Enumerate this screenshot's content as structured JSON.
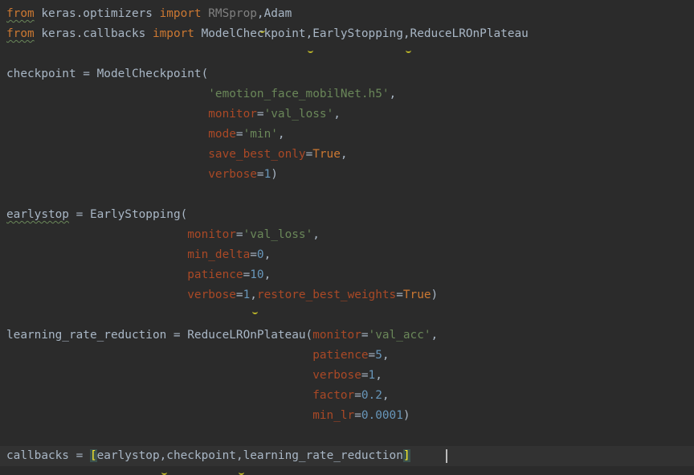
{
  "editor": {
    "lines": [
      [
        {
          "t": "from",
          "c": "kw typo"
        },
        {
          "t": " keras.optimizers ",
          "c": "plain"
        },
        {
          "t": "import",
          "c": "kw"
        },
        {
          "t": " ",
          "c": "plain"
        },
        {
          "t": "RMSprop",
          "c": "unused"
        },
        {
          "t": ",",
          "c": "plain",
          "w": 1
        },
        {
          "t": "Adam",
          "c": "plain"
        }
      ],
      [
        {
          "t": "from",
          "c": "kw typo"
        },
        {
          "t": " keras.callbacks ",
          "c": "plain"
        },
        {
          "t": "import",
          "c": "kw"
        },
        {
          "t": " ModelCheckpoint",
          "c": "plain"
        },
        {
          "t": ",",
          "c": "plain",
          "w": 1
        },
        {
          "t": "EarlyStopping",
          "c": "plain"
        },
        {
          "t": ",",
          "c": "plain",
          "w": 1
        },
        {
          "t": "ReduceLROnPlateau",
          "c": "plain"
        }
      ],
      [],
      [
        {
          "t": "checkpoint = ModelCheckpoint(",
          "c": "plain"
        }
      ],
      [
        {
          "t": "                             ",
          "c": "plain"
        },
        {
          "t": "'emotion_face_mobilNet.h5'",
          "c": "str"
        },
        {
          "t": ",",
          "c": "plain"
        }
      ],
      [
        {
          "t": "                             ",
          "c": "plain"
        },
        {
          "t": "monitor",
          "c": "param"
        },
        {
          "t": "=",
          "c": "plain"
        },
        {
          "t": "'val_loss'",
          "c": "str"
        },
        {
          "t": ",",
          "c": "plain"
        }
      ],
      [
        {
          "t": "                             ",
          "c": "plain"
        },
        {
          "t": "mode",
          "c": "param"
        },
        {
          "t": "=",
          "c": "plain"
        },
        {
          "t": "'min'",
          "c": "str"
        },
        {
          "t": ",",
          "c": "plain"
        }
      ],
      [
        {
          "t": "                             ",
          "c": "plain"
        },
        {
          "t": "save_best_only",
          "c": "param"
        },
        {
          "t": "=",
          "c": "plain"
        },
        {
          "t": "True",
          "c": "kwconst"
        },
        {
          "t": ",",
          "c": "plain"
        }
      ],
      [
        {
          "t": "                             ",
          "c": "plain"
        },
        {
          "t": "verbose",
          "c": "param"
        },
        {
          "t": "=",
          "c": "plain"
        },
        {
          "t": "1",
          "c": "num"
        },
        {
          "t": ")",
          "c": "plain"
        }
      ],
      [],
      [
        {
          "t": "earlystop",
          "c": "plain typo"
        },
        {
          "t": " = EarlyStopping(",
          "c": "plain"
        }
      ],
      [
        {
          "t": "                          ",
          "c": "plain"
        },
        {
          "t": "monitor",
          "c": "param"
        },
        {
          "t": "=",
          "c": "plain"
        },
        {
          "t": "'val_loss'",
          "c": "str"
        },
        {
          "t": ",",
          "c": "plain"
        }
      ],
      [
        {
          "t": "                          ",
          "c": "plain"
        },
        {
          "t": "min_delta",
          "c": "param"
        },
        {
          "t": "=",
          "c": "plain"
        },
        {
          "t": "0",
          "c": "num"
        },
        {
          "t": ",",
          "c": "plain"
        }
      ],
      [
        {
          "t": "                          ",
          "c": "plain"
        },
        {
          "t": "patience",
          "c": "param"
        },
        {
          "t": "=",
          "c": "plain"
        },
        {
          "t": "10",
          "c": "num"
        },
        {
          "t": ",",
          "c": "plain"
        }
      ],
      [
        {
          "t": "                          ",
          "c": "plain"
        },
        {
          "t": "verbose",
          "c": "param"
        },
        {
          "t": "=",
          "c": "plain"
        },
        {
          "t": "1",
          "c": "num"
        },
        {
          "t": ",",
          "c": "plain",
          "w": 1
        },
        {
          "t": "restore_best_weights",
          "c": "param"
        },
        {
          "t": "=",
          "c": "plain"
        },
        {
          "t": "True",
          "c": "kwconst"
        },
        {
          "t": ")",
          "c": "plain"
        }
      ],
      [],
      [
        {
          "t": "learning_rate_reduction = ReduceLROnPlateau(",
          "c": "plain"
        },
        {
          "t": "monitor",
          "c": "param"
        },
        {
          "t": "=",
          "c": "plain"
        },
        {
          "t": "'val_acc'",
          "c": "str"
        },
        {
          "t": ",",
          "c": "plain"
        }
      ],
      [
        {
          "t": "                                            ",
          "c": "plain"
        },
        {
          "t": "patience",
          "c": "param"
        },
        {
          "t": "=",
          "c": "plain"
        },
        {
          "t": "5",
          "c": "num"
        },
        {
          "t": ",",
          "c": "plain"
        }
      ],
      [
        {
          "t": "                                            ",
          "c": "plain"
        },
        {
          "t": "verbose",
          "c": "param"
        },
        {
          "t": "=",
          "c": "plain"
        },
        {
          "t": "1",
          "c": "num"
        },
        {
          "t": ",",
          "c": "plain"
        }
      ],
      [
        {
          "t": "                                            ",
          "c": "plain"
        },
        {
          "t": "factor",
          "c": "param"
        },
        {
          "t": "=",
          "c": "plain"
        },
        {
          "t": "0.2",
          "c": "num"
        },
        {
          "t": ",",
          "c": "plain"
        }
      ],
      [
        {
          "t": "                                            ",
          "c": "plain"
        },
        {
          "t": "min_lr",
          "c": "param"
        },
        {
          "t": "=",
          "c": "plain"
        },
        {
          "t": "0.0001",
          "c": "num"
        },
        {
          "t": ")",
          "c": "plain"
        }
      ],
      [],
      [
        {
          "t": "callbacks = ",
          "c": "plain"
        },
        {
          "t": "[",
          "c": "bracket"
        },
        {
          "t": "earlystop",
          "c": "plain"
        },
        {
          "t": ",",
          "c": "plain",
          "w": 1
        },
        {
          "t": "checkpoint",
          "c": "plain"
        },
        {
          "t": ",",
          "c": "plain",
          "w": 1
        },
        {
          "t": "learning_rate_reduction",
          "c": "plain"
        },
        {
          "t": "]",
          "c": "bracket"
        }
      ]
    ],
    "current_line": 22,
    "colors": {
      "background": "#2b2b2b",
      "current_line": "#323232",
      "keyword": "#cc7832",
      "identifier": "#a9b7c6",
      "string": "#6a8759",
      "number": "#6897bb",
      "parameter": "#aa4926",
      "unused": "#808080",
      "bracket_match": "#ffef28"
    }
  }
}
